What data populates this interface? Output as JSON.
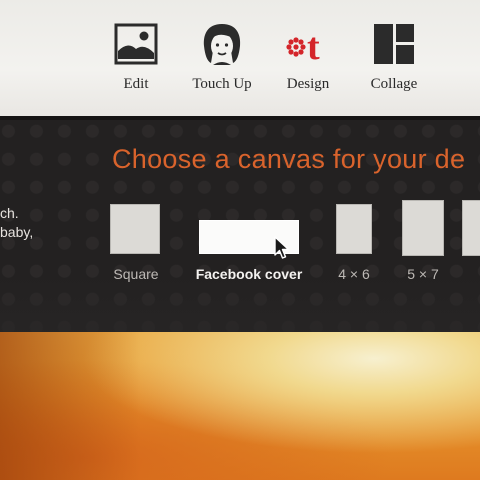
{
  "nav": {
    "items": [
      {
        "label": "Edit",
        "icon": "image-icon"
      },
      {
        "label": "Touch Up",
        "icon": "face-icon"
      },
      {
        "label": "Design",
        "icon": "design-icon"
      },
      {
        "label": "Collage",
        "icon": "collage-icon"
      }
    ],
    "design_glyph": "t",
    "colors": {
      "design_accent": "#d4252a",
      "icon_dark": "#2b2b2b"
    }
  },
  "panel": {
    "title": "Choose a canvas for your de",
    "side_text_line1": "ch.",
    "side_text_line2": "baby,",
    "title_color": "#d9632c",
    "options": [
      {
        "label": "Square",
        "selected": false
      },
      {
        "label": "Facebook cover",
        "selected": true
      },
      {
        "label": "4 × 6",
        "selected": false
      },
      {
        "label": "5 × 7",
        "selected": false
      }
    ]
  }
}
